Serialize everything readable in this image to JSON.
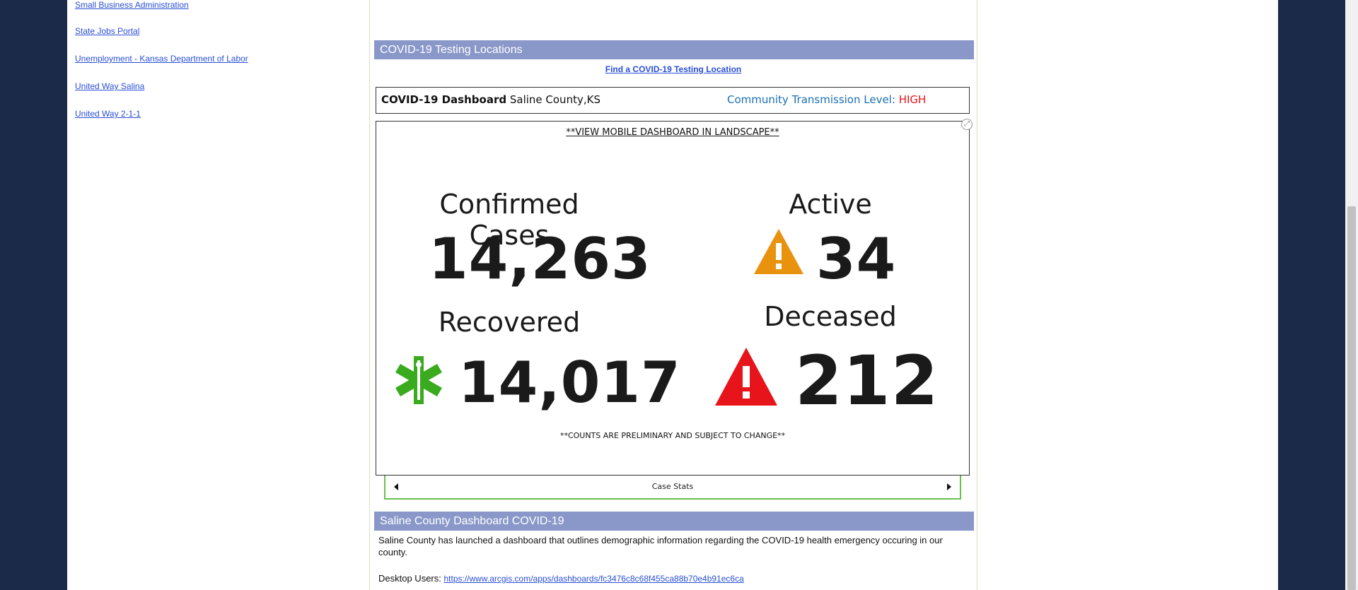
{
  "left_links": [
    {
      "label": "Small Business Administration"
    },
    {
      "label": "State Jobs Portal"
    },
    {
      "label": "Unemployment - Kansas Department of Labor"
    },
    {
      "label": "United Way Salina"
    },
    {
      "label": "United Way 2-1-1"
    }
  ],
  "testing": {
    "section_title": "COVID-19 Testing Locations",
    "find_link": "Find a COVID-19 Testing Location"
  },
  "dashboard_header": {
    "title_bold": "COVID-19 Dashboard",
    "title_rest": "Saline County,KS",
    "transmission_label": "Community Transmission Level:",
    "transmission_value": "HIGH",
    "colors": {
      "transmission_label": "#1a6fb3",
      "transmission_value": "#e8141b"
    }
  },
  "dashboard": {
    "mobile_note": "**VIEW MOBILE DASHBOARD IN LANDSCAPE**",
    "stats": {
      "confirmed": {
        "label": "Confirmed Cases",
        "value": "14,263"
      },
      "active": {
        "label": "Active",
        "value": "34",
        "icon": "warning-icon",
        "icon_color": "#e8920d"
      },
      "recovered": {
        "label": "Recovered",
        "value": "14,017",
        "icon": "star-of-life-icon",
        "icon_color": "#3aaa1e"
      },
      "deceased": {
        "label": "Deceased",
        "value": "212",
        "icon": "warning-icon",
        "icon_color": "#e8141b"
      }
    },
    "disclaimer": "**COUNTS ARE PRELIMINARY AND SUBJECT TO CHANGE**",
    "carousel_label": "Case Stats"
  },
  "saline": {
    "section_title": "Saline County Dashboard COVID-19",
    "description": "Saline County has launched a dashboard that outlines demographic information regarding the COVID-19 health emergency occuring in our county.",
    "desktop_label": "Desktop Users:",
    "desktop_link": "https://www.arcgis.com/apps/dashboards/fc3476c8c68f455ca88b70e4b91ec6ca"
  }
}
